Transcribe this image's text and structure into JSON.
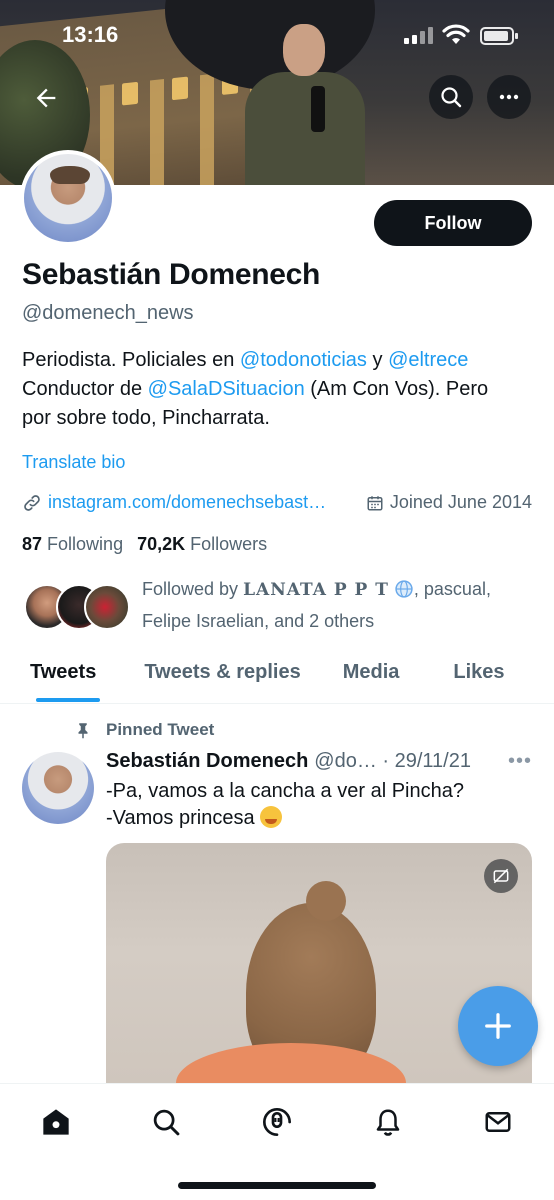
{
  "status_bar": {
    "time": "13:16"
  },
  "profile": {
    "name": "Sebastián Domenech",
    "handle": "@domenech_news",
    "follow_label": "Follow",
    "bio": {
      "line1_pre": "Periodista. Policiales en ",
      "mention1": "@todonoticias",
      "line1_mid": " y ",
      "mention2": "@eltrece",
      "line2_pre": "Conductor de ",
      "mention3": "@SalaDSituacion",
      "line2_post": " (Am Con Vos). Pero",
      "line3": "por sobre todo, Pincharrata."
    },
    "translate_label": "Translate bio",
    "website": "instagram.com/domenechsebast…",
    "joined": "Joined June 2014",
    "following_count": "87",
    "following_label": "Following",
    "followers_count": "70,2K",
    "followers_label": "Followers",
    "followed_by": {
      "prefix": "Followed by ",
      "name1": "LANATA P P T",
      "rest1": ", pascual,",
      "line2": "Felipe Israelian, and 2 others"
    }
  },
  "tabs": [
    {
      "label": "Tweets",
      "active": true
    },
    {
      "label": "Tweets & replies",
      "active": false
    },
    {
      "label": "Media",
      "active": false
    },
    {
      "label": "Likes",
      "active": false
    }
  ],
  "tweet": {
    "pinned_label": "Pinned Tweet",
    "author": "Sebastián Domenech",
    "handle_date": "@do… · 29/11/21",
    "more": "•••",
    "line1": "-Pa, vamos a la cancha a ver al Pincha?",
    "line2": "-Vamos princesa"
  },
  "icons": {
    "back": "arrow-left-icon",
    "search": "search-icon",
    "more": "more-dots-icon",
    "link": "link-icon",
    "calendar": "calendar-icon",
    "pin": "pin-icon",
    "compose": "plus-icon",
    "nav": [
      "home-icon",
      "search-icon",
      "spaces-icon",
      "bell-icon",
      "mail-icon"
    ]
  },
  "colors": {
    "accent": "#1d9bf0",
    "text": "#0f1419",
    "secondary": "#536471",
    "fab": "#4a9de8"
  }
}
